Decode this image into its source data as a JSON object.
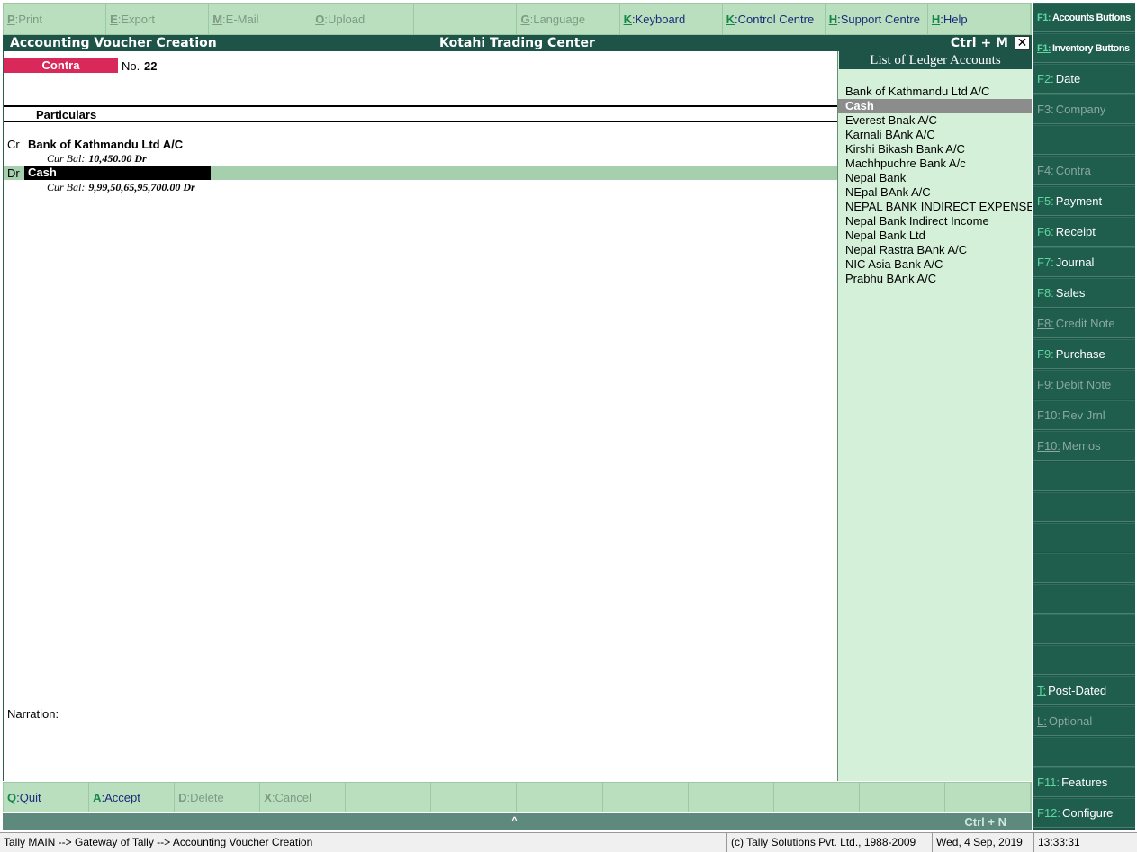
{
  "top_buttons": [
    {
      "key": "P",
      "label": "Print",
      "enabled": false
    },
    {
      "key": "E",
      "label": "Export",
      "enabled": false
    },
    {
      "key": "M",
      "label": "E-Mail",
      "enabled": false
    },
    {
      "key": "O",
      "label": "Upload",
      "enabled": false
    },
    {
      "key": "",
      "label": "",
      "enabled": false
    },
    {
      "key": "G",
      "label": "Language",
      "enabled": false
    },
    {
      "key": "K",
      "label": "Keyboard",
      "enabled": true
    },
    {
      "key": "K",
      "label": "Control Centre",
      "enabled": true
    },
    {
      "key": "H",
      "label": "Support Centre",
      "enabled": true
    },
    {
      "key": "H",
      "label": "Help",
      "enabled": true
    }
  ],
  "titlebar": {
    "left": "Accounting Voucher  Creation",
    "center": "Kotahi Trading Center",
    "right": "Ctrl + M",
    "close": "✕"
  },
  "voucher": {
    "type": "Contra",
    "no_label": "No.",
    "no_value": "22",
    "particulars_label": "Particulars",
    "entries": [
      {
        "side": "Cr",
        "account": "Bank of Kathmandu Ltd A/C",
        "curbal_label": "Cur Bal:",
        "curbal_value": "10,450.00 Dr"
      },
      {
        "side": "Dr",
        "account": "Cash",
        "curbal_label": "Cur Bal:",
        "curbal_value": "9,99,50,65,95,700.00 Dr"
      }
    ],
    "narration_label": "Narration:"
  },
  "ledger_panel": {
    "title": "List of Ledger Accounts",
    "items": [
      "Bank of Kathmandu Ltd A/C",
      "Cash",
      "Everest Bnak A/C",
      "Karnali BAnk A/C",
      "Kirshi Bikash Bank A/C",
      "Machhpuchre Bank A/c",
      "Nepal Bank",
      "NEpal BAnk A/C",
      "NEPAL BANK INDIRECT EXPENSE",
      "Nepal Bank Indirect Income",
      "Nepal Bank Ltd",
      "Nepal Rastra BAnk A/C",
      "NIC Asia Bank A/C",
      "Prabhu BAnk A/C"
    ],
    "selected_index": 1
  },
  "right_buttons": [
    {
      "key": "F1:",
      "label": "Accounts Buttons",
      "enabled": true,
      "small": true
    },
    {
      "key": "F1:",
      "label": "Inventory Buttons",
      "enabled": true,
      "small": true,
      "underline": true
    },
    {
      "key": "F2:",
      "label": "Date",
      "enabled": true
    },
    {
      "key": "F3:",
      "label": "Company",
      "enabled": false
    },
    {
      "key": "",
      "label": "",
      "enabled": false
    },
    {
      "key": "F4:",
      "label": "Contra",
      "enabled": false
    },
    {
      "key": "F5:",
      "label": "Payment",
      "enabled": true
    },
    {
      "key": "F6:",
      "label": "Receipt",
      "enabled": true
    },
    {
      "key": "F7:",
      "label": "Journal",
      "enabled": true
    },
    {
      "key": "F8:",
      "label": "Sales",
      "enabled": true
    },
    {
      "key": "F8:",
      "label": "Credit Note",
      "enabled": false,
      "underline": true
    },
    {
      "key": "F9:",
      "label": "Purchase",
      "enabled": true
    },
    {
      "key": "F9:",
      "label": "Debit Note",
      "enabled": false,
      "underline": true
    },
    {
      "key": "F10:",
      "label": "Rev Jrnl",
      "enabled": false
    },
    {
      "key": "F10:",
      "label": "Memos",
      "enabled": false,
      "underline": true
    },
    {
      "key": "",
      "label": "",
      "enabled": false
    },
    {
      "key": "",
      "label": "",
      "enabled": false
    },
    {
      "key": "",
      "label": "",
      "enabled": false
    },
    {
      "key": "",
      "label": "",
      "enabled": false
    },
    {
      "key": "",
      "label": "",
      "enabled": false
    },
    {
      "key": "",
      "label": "",
      "enabled": false
    },
    {
      "key": "",
      "label": "",
      "enabled": false
    },
    {
      "key": "T:",
      "label": "Post-Dated",
      "enabled": true,
      "underline": true
    },
    {
      "key": "L:",
      "label": "Optional",
      "enabled": false,
      "underline": true
    },
    {
      "key": "",
      "label": "",
      "enabled": false
    },
    {
      "key": "F11:",
      "label": "Features",
      "enabled": true
    },
    {
      "key": "F12:",
      "label": "Configure",
      "enabled": true
    }
  ],
  "bottom_buttons": [
    {
      "key": "Q",
      "label": "Quit",
      "enabled": true
    },
    {
      "key": "A",
      "label": "Accept",
      "enabled": true
    },
    {
      "key": "D",
      "label": "Delete",
      "enabled": false
    },
    {
      "key": "X",
      "label": "Cancel",
      "enabled": false
    },
    {
      "key": "",
      "label": "",
      "enabled": false
    },
    {
      "key": "",
      "label": "",
      "enabled": false
    },
    {
      "key": "",
      "label": "",
      "enabled": false
    },
    {
      "key": "",
      "label": "",
      "enabled": false
    },
    {
      "key": "",
      "label": "",
      "enabled": false
    },
    {
      "key": "",
      "label": "",
      "enabled": false
    },
    {
      "key": "",
      "label": "",
      "enabled": false
    },
    {
      "key": "",
      "label": "",
      "enabled": false
    }
  ],
  "ctrl_n_bar": {
    "up_arrow": "^",
    "label": "Ctrl + N"
  },
  "statusbar": {
    "path": "Tally MAIN --> Gateway of Tally --> Accounting Voucher  Creation",
    "copyright": "(c) Tally Solutions Pvt. Ltd., 1988-2009",
    "date": "Wed, 4 Sep, 2019",
    "time": "13:33:31"
  }
}
